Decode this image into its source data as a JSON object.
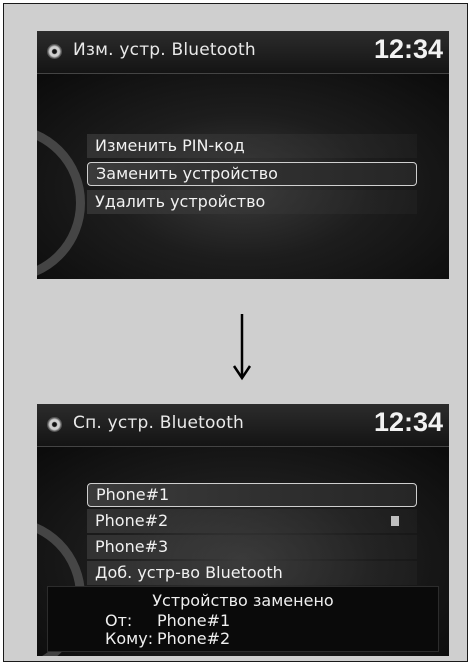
{
  "screen1": {
    "title": "Изм. устр. Bluetooth",
    "time": "12:34",
    "menu": [
      "Изменить PIN-код",
      "Заменить устройство",
      "Удалить устройство"
    ]
  },
  "screen2": {
    "title": "Сп. устр. Bluetooth",
    "time": "12:34",
    "menu": [
      "Phone#1",
      "Phone#2",
      "Phone#3",
      "Доб. устр-во Bluetooth"
    ],
    "notice": {
      "title": "Устройство заменено",
      "from_label": "От:",
      "from_value": "Phone#1",
      "to_label": "Кому:",
      "to_value": "Phone#2"
    }
  },
  "icons": {
    "header": "gear-icon",
    "transition": "arrow-down-icon",
    "selected_device": "phone-connected-icon"
  }
}
